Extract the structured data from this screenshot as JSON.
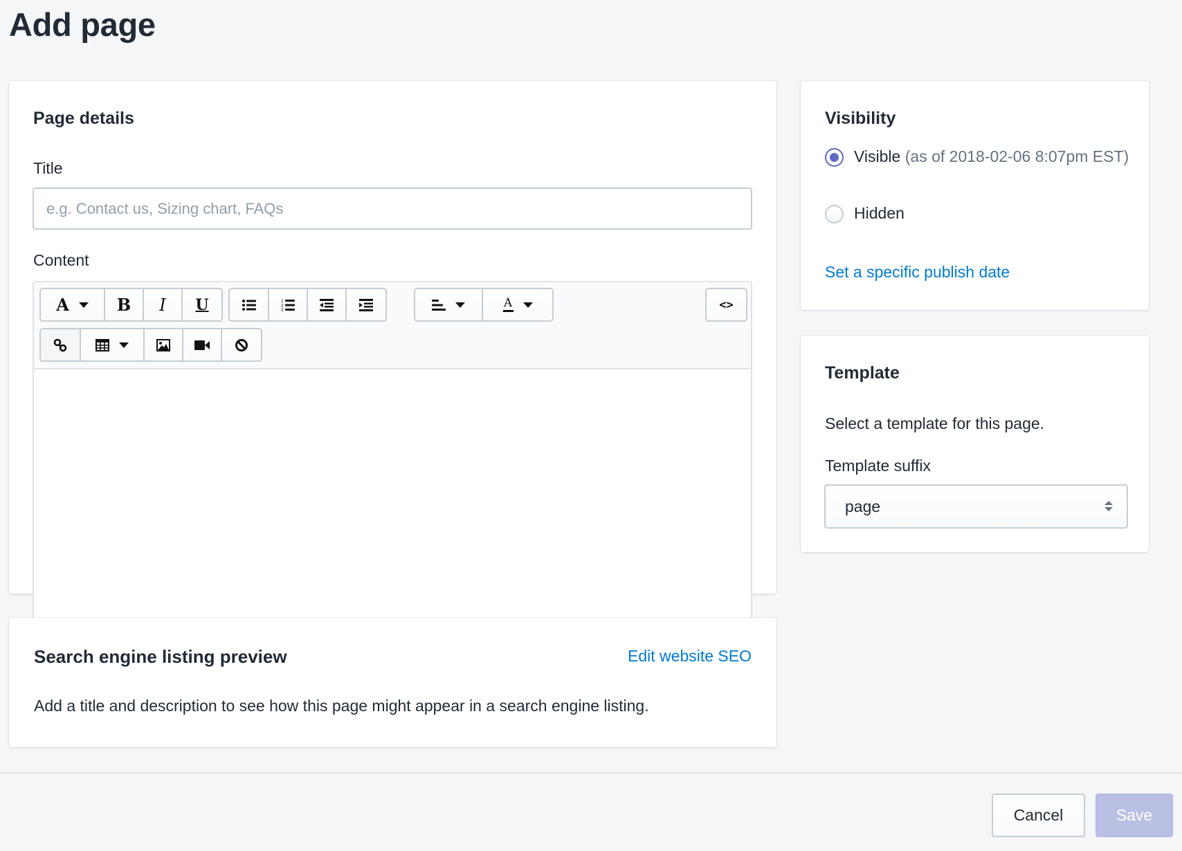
{
  "page": {
    "title": "Add page"
  },
  "details": {
    "heading": "Page details",
    "title_label": "Title",
    "title_value": "",
    "title_placeholder": "e.g. Contact us, Sizing chart, FAQs",
    "content_label": "Content",
    "content_value": "",
    "toolbar": {
      "row1": [
        {
          "group": "text",
          "buttons": [
            {
              "icon": "font-style-icon",
              "label": "A",
              "dropdown": true
            },
            {
              "icon": "bold-icon",
              "label": "B"
            },
            {
              "icon": "italic-icon",
              "label": "I"
            },
            {
              "icon": "underline-icon",
              "label": "U"
            }
          ]
        },
        {
          "group": "lists",
          "buttons": [
            {
              "icon": "bulleted-list-icon"
            },
            {
              "icon": "numbered-list-icon"
            },
            {
              "icon": "outdent-icon"
            },
            {
              "icon": "indent-icon"
            }
          ]
        },
        {
          "group": "align-color",
          "buttons": [
            {
              "icon": "align-left-icon",
              "dropdown": true
            },
            {
              "icon": "text-color-icon",
              "label": "A",
              "dropdown": true
            }
          ]
        },
        {
          "group": "source",
          "buttons": [
            {
              "icon": "code-view-icon",
              "label": "<>"
            }
          ]
        }
      ],
      "row2": [
        {
          "group": "insert",
          "buttons": [
            {
              "icon": "link-icon",
              "active": true
            },
            {
              "icon": "table-icon",
              "dropdown": true
            },
            {
              "icon": "image-icon"
            },
            {
              "icon": "video-icon"
            },
            {
              "icon": "clear-formatting-icon"
            }
          ]
        }
      ]
    }
  },
  "seo": {
    "heading": "Search engine listing preview",
    "edit_link": "Edit website SEO",
    "description": "Add a title and description to see how this page might appear in a search engine listing."
  },
  "visibility": {
    "heading": "Visibility",
    "options": [
      {
        "label": "Visible",
        "sublabel": "(as of 2018-02-06 8:07pm EST)",
        "checked": true
      },
      {
        "label": "Hidden",
        "sublabel": "",
        "checked": false
      }
    ],
    "publish_link": "Set a specific publish date"
  },
  "template": {
    "heading": "Template",
    "description": "Select a template for this page.",
    "suffix_label": "Template suffix",
    "suffix_value": "page"
  },
  "footer": {
    "cancel_label": "Cancel",
    "save_label": "Save",
    "save_disabled": true
  },
  "colors": {
    "background": "#f4f6f8",
    "text": "#212b36",
    "link": "#007ace",
    "primary": "#5c6ac4",
    "primary_disabled": "#bac0e4",
    "border": "#c4cdd5"
  }
}
